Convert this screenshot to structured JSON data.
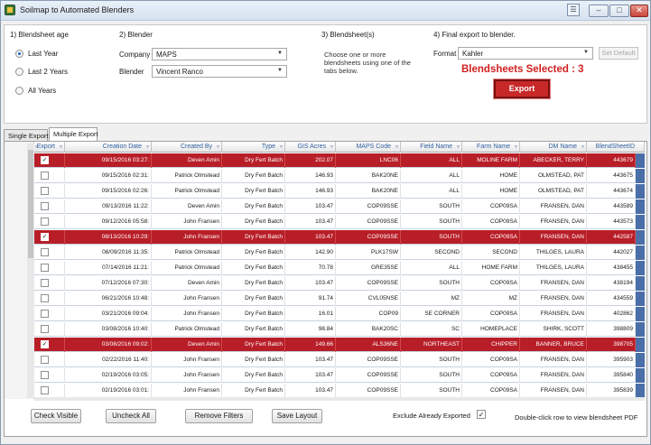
{
  "window": {
    "title": "Soilmap to Automated Blenders",
    "extra_icon": "☰",
    "minimize": "–",
    "maximize": "□",
    "close": "✕"
  },
  "section1": {
    "label": "1) Blendsheet age",
    "options": [
      "Last Year",
      "Last 2 Years",
      "All Years"
    ],
    "selected": "Last Year"
  },
  "section2": {
    "label": "2) Blender",
    "company_label": "Company",
    "company_value": "MAPS",
    "blender_label": "Blender",
    "blender_value": "Vincent Ranco"
  },
  "section3": {
    "label": "3) Blendsheet(s)",
    "note": "Choose one or more blendsheets using one of the tabs below."
  },
  "section4": {
    "label": "4) Final export to blender.",
    "format_label": "Format",
    "format_value": "Kahler",
    "set_default": "Set Default"
  },
  "selected_text": "Blendsheets Selected : 3",
  "export_label": "Export",
  "tabs": [
    "Single Export",
    "Multiple Export"
  ],
  "active_tab": "Multiple Export",
  "grid": {
    "columns": [
      "Export",
      "Creation Date",
      "Created By",
      "Type",
      "GIS Acres",
      "MAPS Code",
      "Field Name",
      "Farm Name",
      "DM Name",
      "BlendSheetID"
    ],
    "rows": [
      {
        "checked": true,
        "date": "09/15/2016 03:27:",
        "by": "Deven Amin",
        "type": "Dry Fert Batch",
        "acres": "202.07",
        "code": "LNC06",
        "field": "ALL",
        "farm": "MOLINE FARM",
        "dm": "ABECKER, TERRY",
        "id": "443679"
      },
      {
        "checked": false,
        "date": "09/15/2016 02:31:",
        "by": "Patrick Olmstead",
        "type": "Dry Fert Batch",
        "acres": "146.93",
        "code": "BAK20NE",
        "field": "ALL",
        "farm": "HOME",
        "dm": "OLMSTEAD, PAT",
        "id": "443675"
      },
      {
        "checked": false,
        "date": "09/15/2016 02:26:",
        "by": "Patrick Olmstead",
        "type": "Dry Fert Batch",
        "acres": "146.93",
        "code": "BAK20NE",
        "field": "ALL",
        "farm": "HOME",
        "dm": "OLMSTEAD, PAT",
        "id": "443674"
      },
      {
        "checked": false,
        "date": "09/13/2016 11:22:",
        "by": "Deven Amin",
        "type": "Dry Fert Batch",
        "acres": "103.47",
        "code": "COP09SSE",
        "field": "SOUTH",
        "farm": "COP09SA",
        "dm": "FRANSEN, DAN",
        "id": "443589"
      },
      {
        "checked": false,
        "date": "09/12/2016 05:58:",
        "by": "John Fransen",
        "type": "Dry Fert Batch",
        "acres": "103.47",
        "code": "COP09SSE",
        "field": "SOUTH",
        "farm": "COP09SA",
        "dm": "FRANSEN, DAN",
        "id": "443573"
      },
      {
        "checked": true,
        "date": "08/13/2016 10:29:",
        "by": "John Fransen",
        "type": "Dry Fert Batch",
        "acres": "103.47",
        "code": "COP09SSE",
        "field": "SOUTH",
        "farm": "COP09SA",
        "dm": "FRANSEN, DAN",
        "id": "442587"
      },
      {
        "checked": false,
        "date": "08/09/2016 11:35:",
        "by": "Patrick Olmstead",
        "type": "Dry Fert Batch",
        "acres": "142.90",
        "code": "PLK17SW",
        "field": "SECOND",
        "farm": "SECOND",
        "dm": "THILGES, LAURA",
        "id": "442027"
      },
      {
        "checked": false,
        "date": "07/14/2016 11:21:",
        "by": "Patrick Olmstead",
        "type": "Dry Fert Batch",
        "acres": "70.78",
        "code": "GRE35SE",
        "field": "ALL",
        "farm": "HOME FARM",
        "dm": "THILGES, LAURA",
        "id": "438455"
      },
      {
        "checked": false,
        "date": "07/12/2016 07:30:",
        "by": "Deven Amin",
        "type": "Dry Fert Batch",
        "acres": "103.47",
        "code": "COP09SSE",
        "field": "SOUTH",
        "farm": "COP09SA",
        "dm": "FRANSEN, DAN",
        "id": "438194"
      },
      {
        "checked": false,
        "date": "06/21/2016 10:48:",
        "by": "John Fransen",
        "type": "Dry Fert Batch",
        "acres": "91.74",
        "code": "CVL05NSE",
        "field": "MZ",
        "farm": "MZ",
        "dm": "FRANSEN, DAN",
        "id": "434559"
      },
      {
        "checked": false,
        "date": "03/21/2016 09:04:",
        "by": "John Fransen",
        "type": "Dry Fert Batch",
        "acres": "16.01",
        "code": "COP09",
        "field": "SE CORNER",
        "farm": "COP09SA",
        "dm": "FRANSEN, DAN",
        "id": "402862"
      },
      {
        "checked": false,
        "date": "03/08/2016 10:40:",
        "by": "Patrick Olmstead",
        "type": "Dry Fert Batch",
        "acres": "98.84",
        "code": "BAK20SC",
        "field": "SC",
        "farm": "HOMEPLACE",
        "dm": "SHIRK, SCOTT",
        "id": "398809"
      },
      {
        "checked": true,
        "date": "03/08/2016 09:02:",
        "by": "Deven Amin",
        "type": "Dry Fert Batch",
        "acres": "149.66",
        "code": "ALS36NE",
        "field": "NORTHEAST",
        "farm": "CHIPPER",
        "dm": "BANNER, BRUCE",
        "id": "398705"
      },
      {
        "checked": false,
        "date": "02/22/2016 11:40:",
        "by": "John Fransen",
        "type": "Dry Fert Batch",
        "acres": "103.47",
        "code": "COP09SSE",
        "field": "SOUTH",
        "farm": "COP09SA",
        "dm": "FRANSEN, DAN",
        "id": "395903"
      },
      {
        "checked": false,
        "date": "02/19/2016 03:05:",
        "by": "John Fransen",
        "type": "Dry Fert Batch",
        "acres": "103.47",
        "code": "COP09SSE",
        "field": "SOUTH",
        "farm": "COP09SA",
        "dm": "FRANSEN, DAN",
        "id": "395840"
      },
      {
        "checked": false,
        "date": "02/19/2016 03:01:",
        "by": "John Fransen",
        "type": "Dry Fert Batch",
        "acres": "103.47",
        "code": "COP09SSE",
        "field": "SOUTH",
        "farm": "COP09SA",
        "dm": "FRANSEN, DAN",
        "id": "395839"
      }
    ]
  },
  "bottom": {
    "check_visible": "Check Visible",
    "uncheck_all": "Uncheck All",
    "remove_filters": "Remove Filters",
    "save_layout": "Save Layout",
    "exclude_label": "Exclude Already Exported",
    "exclude_checked": true,
    "hint": "Double-click row to view blendsheet PDF"
  },
  "colors": {
    "selected_row": "#b81e28",
    "accent_text": "#d02020",
    "header_text": "#3060a0"
  }
}
